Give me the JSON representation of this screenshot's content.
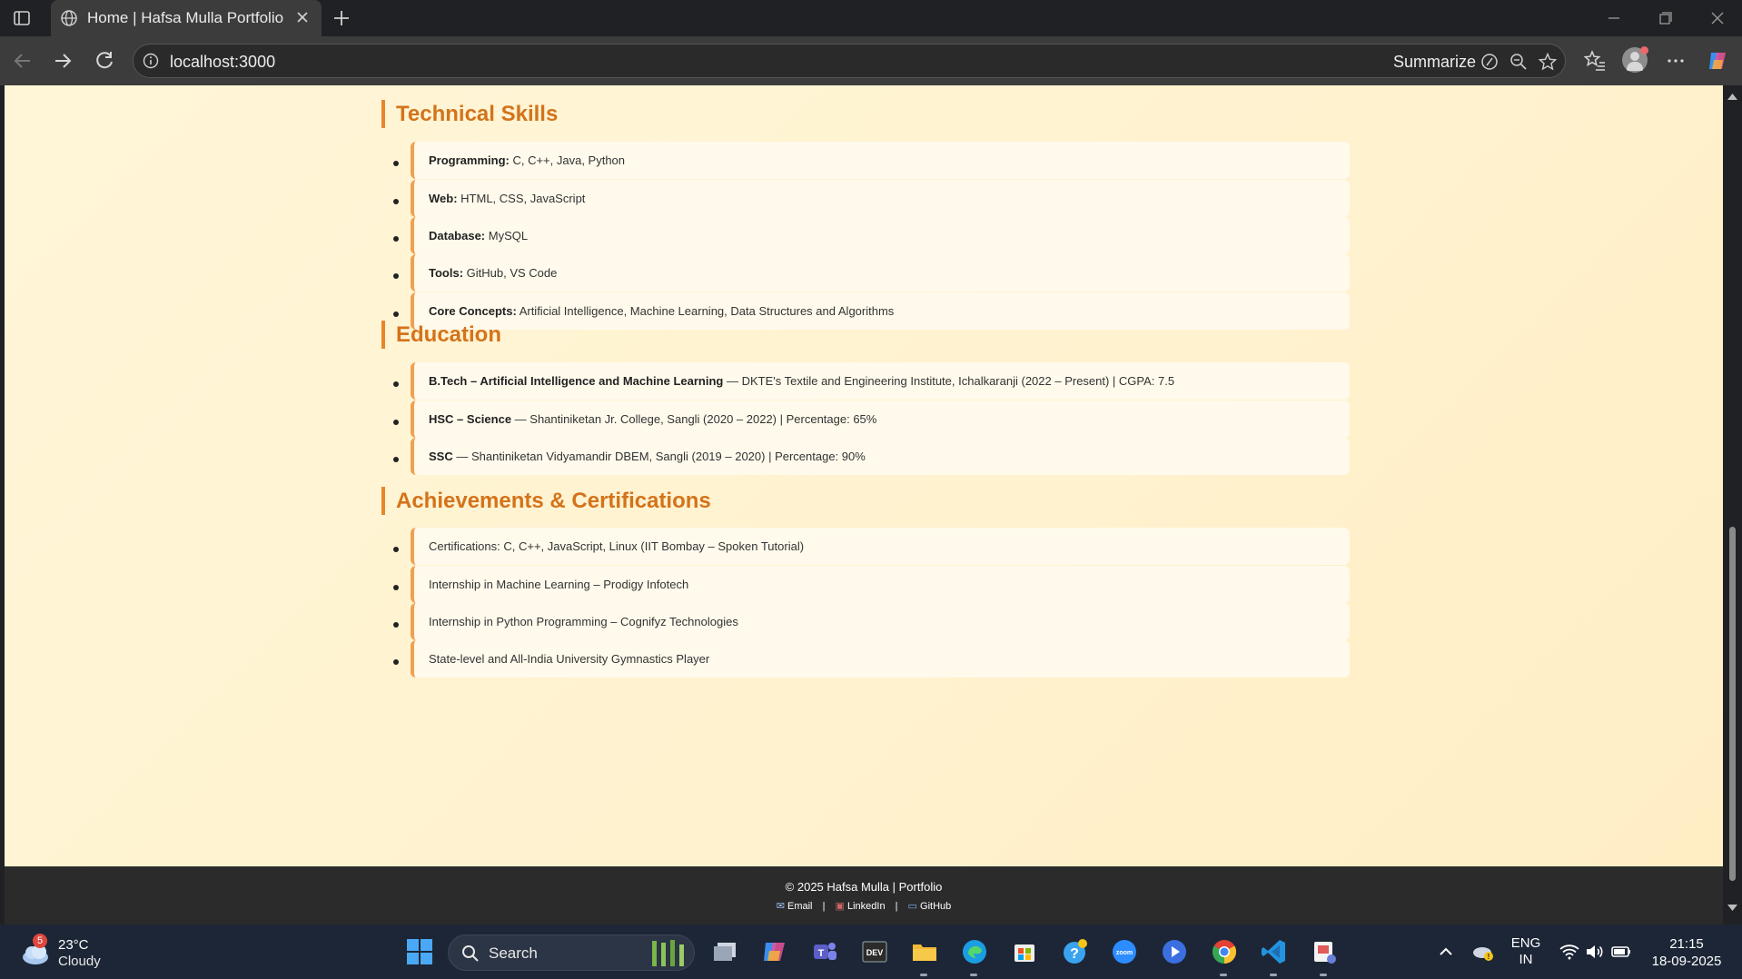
{
  "browser": {
    "tab_title": "Home | Hafsa Mulla Portfolio",
    "url": "localhost:3000",
    "summarize_label": "Summarize"
  },
  "sections": [
    {
      "title": "Technical Skills",
      "items": [
        {
          "label": "Programming:",
          "text": " C, C++, Java, Python"
        },
        {
          "label": "Web:",
          "text": " HTML, CSS, JavaScript"
        },
        {
          "label": "Database:",
          "text": " MySQL"
        },
        {
          "label": "Tools:",
          "text": " GitHub, VS Code"
        },
        {
          "label": "Core Concepts:",
          "text": " Artificial Intelligence, Machine Learning, Data Structures and Algorithms"
        }
      ]
    },
    {
      "title": "Education",
      "items": [
        {
          "label": "B.Tech – Artificial Intelligence and Machine Learning",
          "text": " — DKTE's Textile and Engineering Institute, Ichalkaranji (2022 – Present) | CGPA: 7.5"
        },
        {
          "label": "HSC – Science",
          "text": " — Shantiniketan Jr. College, Sangli (2020 – 2022) | Percentage: 65%"
        },
        {
          "label": "SSC",
          "text": " — Shantiniketan Vidyamandir DBEM, Sangli (2019 – 2020) | Percentage: 90%"
        }
      ]
    },
    {
      "title": "Achievements & Certifications",
      "items": [
        {
          "label": "",
          "text": "Certifications: C, C++, JavaScript, Linux (IIT Bombay – Spoken Tutorial)"
        },
        {
          "label": "",
          "text": "Internship in Machine Learning – Prodigy Infotech"
        },
        {
          "label": "",
          "text": "Internship in Python Programming – Cognifyz Technologies"
        },
        {
          "label": "",
          "text": "State-level and All-India University Gymnastics Player"
        }
      ]
    }
  ],
  "footer": {
    "copyright": "© 2025 Hafsa Mulla | Portfolio",
    "email": "Email",
    "linkedin": "LinkedIn",
    "github": "GitHub",
    "separator": "|"
  },
  "taskbar": {
    "weather_badge": "5",
    "temperature": "23°C",
    "condition": "Cloudy",
    "search_label": "Search",
    "lang_line1": "ENG",
    "lang_line2": "IN",
    "time": "21:15",
    "date": "18-09-2025"
  },
  "colors": {
    "accent": "#e8862a",
    "heading": "#d4731a",
    "page_bg": "#fff6d8",
    "card_bg": "#fffaec",
    "footer_bg": "#2b2b2b"
  }
}
